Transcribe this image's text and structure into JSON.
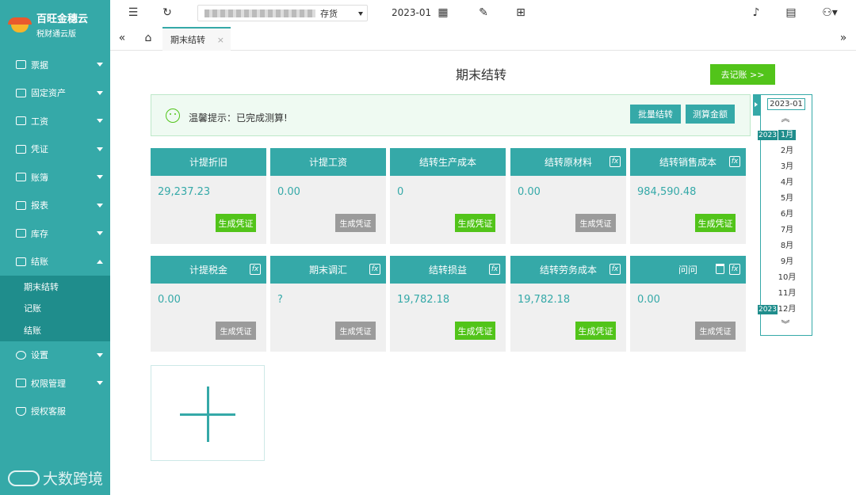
{
  "sidebar": {
    "brand": "百旺金穗云",
    "edition": "税财通云版",
    "items": [
      {
        "label": "票据",
        "icon": "ticket-icon"
      },
      {
        "label": "固定资产",
        "icon": "building-icon"
      },
      {
        "label": "工资",
        "icon": "monitor-icon"
      },
      {
        "label": "凭证",
        "icon": "voucher-icon"
      },
      {
        "label": "账簿",
        "icon": "ledger-icon"
      },
      {
        "label": "报表",
        "icon": "chart-icon"
      },
      {
        "label": "库存",
        "icon": "stock-icon"
      },
      {
        "label": "结账",
        "icon": "checkout-icon"
      },
      {
        "label": "设置",
        "icon": "gear-icon"
      },
      {
        "label": "权限管理",
        "icon": "folder-icon"
      },
      {
        "label": "授权客服",
        "icon": "shield-icon"
      }
    ],
    "submenu": [
      "期末结转",
      "记账",
      "结账"
    ],
    "watermark": "大数跨境"
  },
  "topbar": {
    "company_suffix": "存货",
    "period": "2023-01"
  },
  "tabs": {
    "active": "期末结转"
  },
  "page": {
    "title": "期末结转",
    "goto_ledger": "去记账 >>",
    "notice": "温馨提示：已完成测算!",
    "batch_button": "批量结转",
    "calc_button": "测算金额"
  },
  "cards": [
    {
      "title": "计提折旧",
      "value": "29,237.23",
      "button": "生成凭证",
      "state": "green"
    },
    {
      "title": "计提工资",
      "value": "0.00",
      "button": "生成凭证",
      "state": "gray"
    },
    {
      "title": "结转生产成本",
      "value": "0",
      "button": "生成凭证",
      "state": "green"
    },
    {
      "title": "结转原材料",
      "value": "0.00",
      "button": "生成凭证",
      "state": "gray"
    },
    {
      "title": "结转销售成本",
      "value": "984,590.48",
      "button": "生成凭证",
      "state": "green"
    },
    {
      "title": "计提税金",
      "value": "0.00",
      "button": "生成凭证",
      "state": "gray"
    },
    {
      "title": "期末调汇",
      "value": "?",
      "button": "生成凭证",
      "state": "gray"
    },
    {
      "title": "结转损益",
      "value": "19,782.18",
      "button": "生成凭证",
      "state": "green"
    },
    {
      "title": "结转劳务成本",
      "value": "19,782.18",
      "button": "生成凭证",
      "state": "green"
    },
    {
      "title": "问问",
      "value": "0.00",
      "button": "生成凭证",
      "state": "gray"
    }
  ],
  "month_picker": {
    "year_label": "2023-01",
    "months": [
      "1月",
      "2月",
      "3月",
      "4月",
      "5月",
      "6月",
      "7月",
      "8月",
      "9月",
      "10月",
      "11月",
      "12月"
    ],
    "year_badge": "2023",
    "active_month": "1月"
  },
  "colors": {
    "primary": "#35a9a8",
    "primary_dark": "#1f8d8c",
    "success": "#52c41a",
    "disabled": "#9b9b9b"
  }
}
